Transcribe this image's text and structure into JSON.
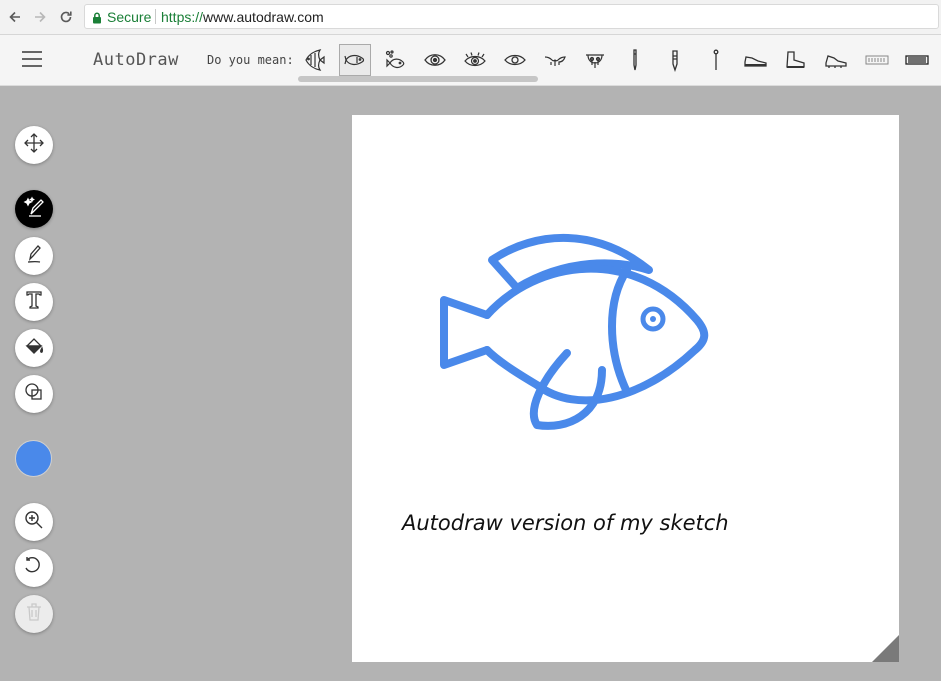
{
  "browser": {
    "secure_label": "Secure",
    "url_scheme": "https://",
    "url_host": "www.autodraw.com"
  },
  "app": {
    "title": "AutoDraw",
    "suggest_label": "Do you mean:",
    "suggestions": [
      "angelfish",
      "fish",
      "fish-bubbles",
      "eye",
      "eye-lashes",
      "eye-outline",
      "mustache",
      "bra",
      "pen",
      "crayon",
      "pin",
      "sneaker",
      "boot",
      "cleat",
      "keyboard",
      "keyboard-dark"
    ]
  },
  "tools": [
    "move-icon",
    "autodraw-icon",
    "draw-icon",
    "type-icon",
    "fill-icon",
    "shape-icon"
  ],
  "color": {
    "current": "#4a89ea"
  },
  "canvas": {
    "caption": "Autodraw version of my sketch",
    "fish_color": "#4a89ea"
  }
}
